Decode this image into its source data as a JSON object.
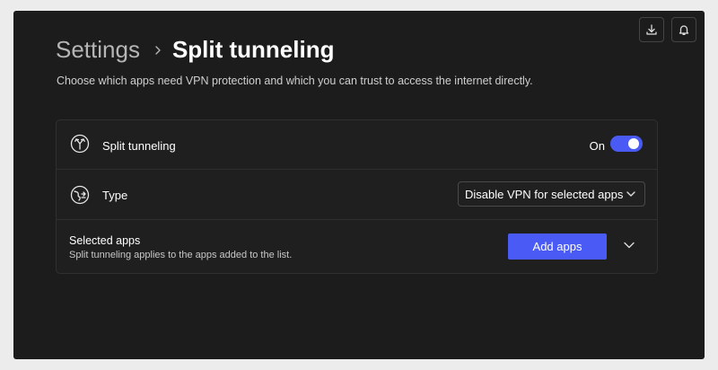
{
  "toolbar": {
    "download_icon": "download-icon",
    "bell_icon": "bell-icon"
  },
  "header": {
    "breadcrumb_parent": "Settings",
    "breadcrumb_current": "Split tunneling",
    "subtitle": "Choose which apps need VPN protection and which you can trust to access the internet directly."
  },
  "split_tunneling": {
    "icon": "split-icon",
    "label": "Split tunneling",
    "state_label": "On",
    "enabled": true
  },
  "type": {
    "icon": "globe-split-icon",
    "label": "Type",
    "selected": "Disable VPN for selected apps"
  },
  "selected_apps": {
    "title": "Selected apps",
    "description": "Split tunneling applies to the apps added to the list.",
    "add_button_label": "Add apps"
  },
  "colors": {
    "accent": "#4a5bf5",
    "background": "#1c1c1c"
  }
}
